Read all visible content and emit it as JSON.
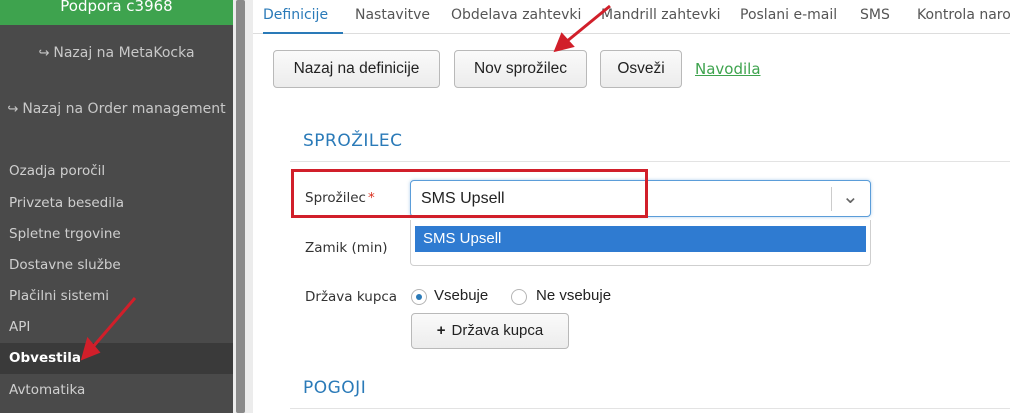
{
  "sidebar": {
    "support": "Podpora c3968",
    "back_metakocka": "Nazaj na MetaKocka",
    "back_order": "Nazaj na Order management",
    "items": [
      {
        "label": "Ozadja poročil"
      },
      {
        "label": "Privzeta besedila"
      },
      {
        "label": "Spletne trgovine"
      },
      {
        "label": "Dostavne službe"
      },
      {
        "label": "Plačilni sistemi"
      },
      {
        "label": "API"
      },
      {
        "label": "Obvestila"
      },
      {
        "label": "Avtomatika"
      }
    ],
    "active_item": "Obvestila"
  },
  "tabs": [
    {
      "label": "Definicije"
    },
    {
      "label": "Nastavitve"
    },
    {
      "label": "Obdelava zahtevki"
    },
    {
      "label": "Mandrill zahtevki"
    },
    {
      "label": "Poslani e-mail"
    },
    {
      "label": "SMS"
    },
    {
      "label": "Kontrola naroč"
    }
  ],
  "active_tab": "Definicije",
  "toolbar": {
    "back_label": "Nazaj na definicije",
    "new_trigger_label": "Nov sprožilec",
    "refresh_label": "Osveži",
    "help_link": "Navodila"
  },
  "section_trigger": {
    "title": "SPROŽILEC",
    "trigger_label": "Sprožilec",
    "required_mark": "*",
    "trigger_value": "SMS Upsell",
    "dropdown_option": "SMS Upsell",
    "delay_label": "Zamik (min)",
    "country_label": "Država kupca",
    "radio_contains": "Vsebuje",
    "radio_not_contains": "Ne vsebuje",
    "radio_selected": "Vsebuje",
    "add_country_label": "Država kupca"
  },
  "section_conditions": {
    "title": "POGOJI"
  },
  "colors": {
    "sidebar_bg": "#4a4a4a",
    "accent_green": "#3ea34e",
    "accent_blue": "#2a7ab8",
    "annotation_red": "#d11f2a"
  }
}
